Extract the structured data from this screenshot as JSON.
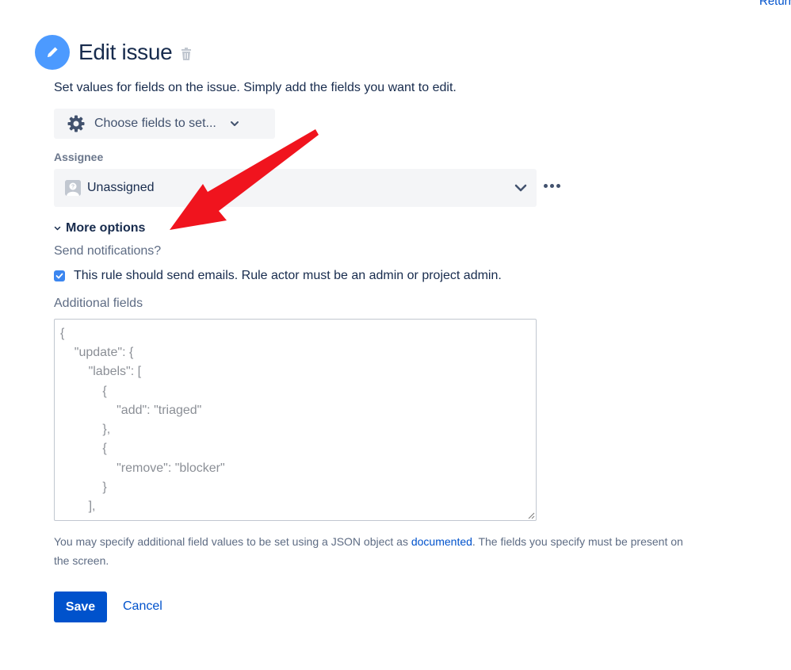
{
  "return_link": "Return",
  "header": {
    "icon": "pencil-icon",
    "title": "Edit issue",
    "delete_icon": "trash-icon"
  },
  "description": "Set values for fields on the issue. Simply add the fields you want to edit.",
  "choose_fields": {
    "icon": "gear-icon",
    "label": "Choose fields to set...",
    "chevron": "chevron-down-icon"
  },
  "assignee": {
    "label": "Assignee",
    "value": "Unassigned",
    "avatar_icon": "unknown-user-avatar-icon",
    "chevron": "chevron-down-icon",
    "more_icon": "more-horizontal-icon"
  },
  "more_options": {
    "label": "More options",
    "icon": "chevron-down-icon"
  },
  "notifications": {
    "label": "Send notifications?",
    "checked": true,
    "checkbox_label": "This rule should send emails. Rule actor must be an admin or project admin."
  },
  "additional_fields": {
    "label": "Additional fields",
    "lines": [
      "{",
      "    \"update\": {",
      "        \"labels\": [",
      "            {",
      "                \"add\": \"triaged\"",
      "            },",
      "            {",
      "                \"remove\": \"blocker\"",
      "            }",
      "        ],"
    ]
  },
  "help": {
    "before": "You may specify additional field values to be set using a JSON object as ",
    "link": "documented",
    "after": ". The fields you specify must be present on the screen."
  },
  "actions": {
    "save": "Save",
    "cancel": "Cancel"
  },
  "colors": {
    "primary": "#0052cc",
    "header_icon_bg": "#4c9aff",
    "field_bg": "#f4f5f7",
    "annotation_arrow": "#f0141e"
  }
}
